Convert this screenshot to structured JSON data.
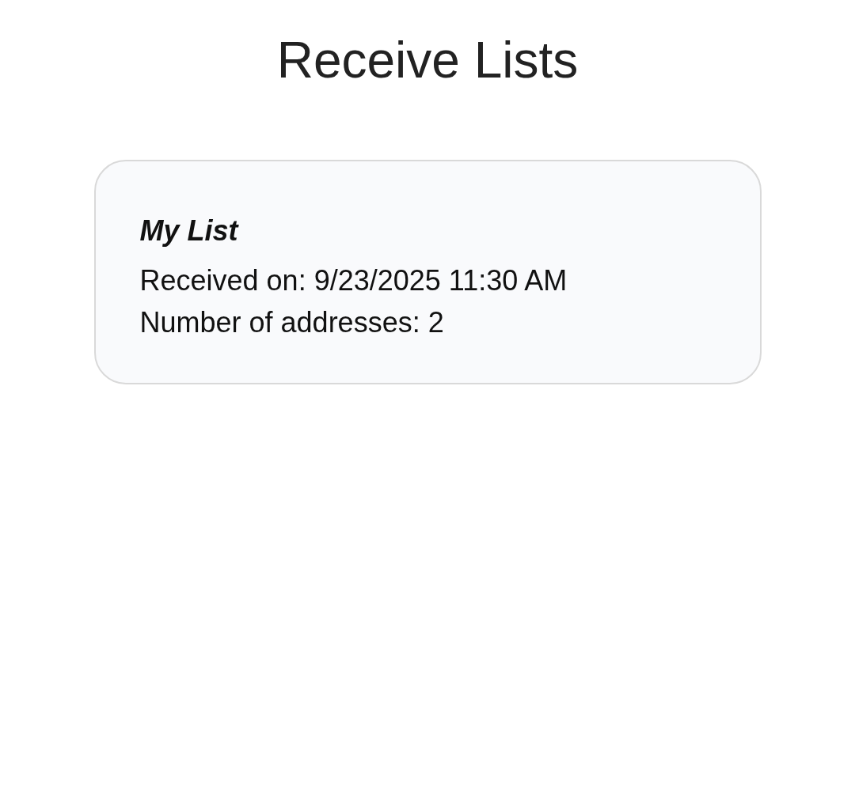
{
  "page_title": "Receive Lists",
  "lists": [
    {
      "name": "My List",
      "received": "Received on: 9/23/2025 11:30 AM",
      "count": "Number of addresses: 2"
    }
  ]
}
